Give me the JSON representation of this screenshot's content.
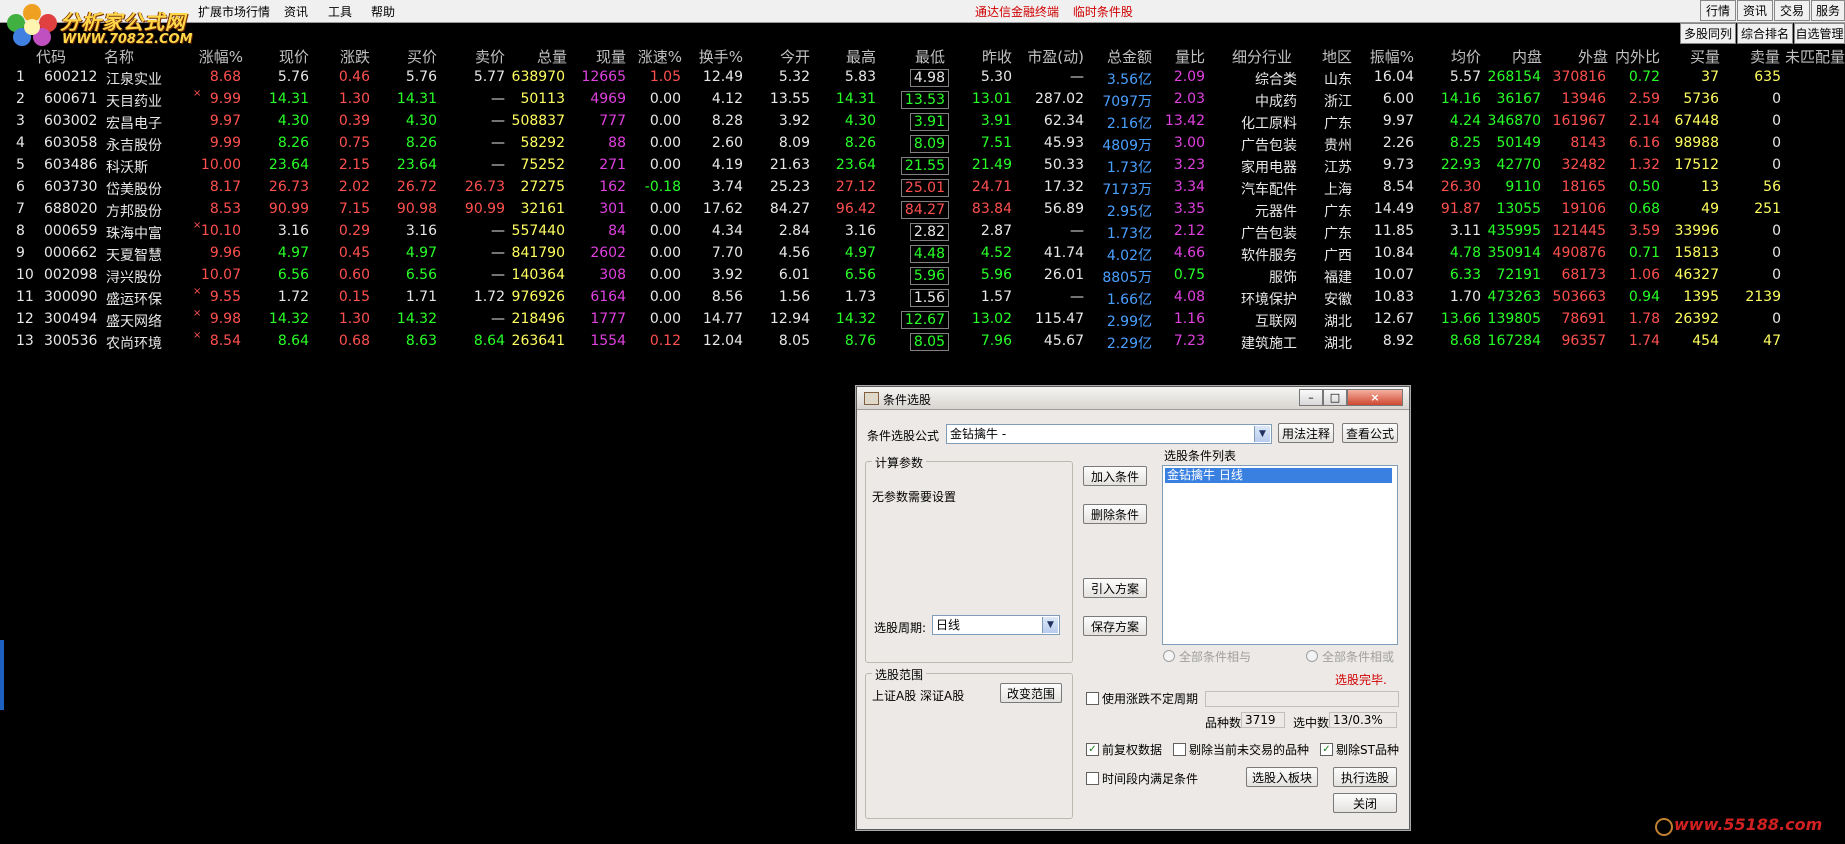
{
  "logo": {
    "brand": "分析家公式网",
    "url": "WWW.70822.COM"
  },
  "menu": [
    "扩展市场行情",
    "资讯",
    "工具",
    "帮助"
  ],
  "center_links": [
    "通达信金融终端",
    "临时条件股"
  ],
  "right_buttons": [
    "行情",
    "资讯",
    "交易",
    "服务"
  ],
  "right_buttons2": [
    "多股同列",
    "综合排名",
    "自选管理"
  ],
  "columns": [
    "代码",
    "名称",
    "涨幅%",
    "现价",
    "涨跌",
    "买价",
    "卖价",
    "总量",
    "现量",
    "涨速%",
    "换手%",
    "今开",
    "最高",
    "最低",
    "昨收",
    "市盈(动)",
    "总金额",
    "量比",
    "细分行业",
    "地区",
    "振幅%",
    "均价",
    "内盘",
    "外盘",
    "内外比",
    "买量",
    "卖量",
    "未匹配量"
  ],
  "rows": [
    [
      "1",
      "600212",
      "江泉实业",
      "",
      "8.68",
      "5.76",
      "0.46",
      "5.76",
      "5.77",
      "638970",
      "12665",
      "1.05",
      "12.49",
      "5.32",
      "5.83",
      "4.98",
      "5.30",
      "—",
      "3.56亿",
      "2.09",
      "综合类",
      "山东",
      "16.04",
      "5.57",
      "268154",
      "370816",
      "0.72",
      "37",
      "635"
    ],
    [
      "2",
      "600671",
      "天目药业",
      "×",
      "9.99",
      "14.31",
      "1.30",
      "14.31",
      "—",
      "50113",
      "4969",
      "0.00",
      "4.12",
      "13.55",
      "14.31",
      "13.53",
      "13.01",
      "287.02",
      "7097万",
      "2.03",
      "中成药",
      "浙江",
      "6.00",
      "14.16",
      "36167",
      "13946",
      "2.59",
      "5736",
      "0"
    ],
    [
      "3",
      "603002",
      "宏昌电子",
      "",
      "9.97",
      "4.30",
      "0.39",
      "4.30",
      "—",
      "508837",
      "777",
      "0.00",
      "8.28",
      "3.92",
      "4.30",
      "3.91",
      "3.91",
      "62.34",
      "2.16亿",
      "13.42",
      "化工原料",
      "广东",
      "9.97",
      "4.24",
      "346870",
      "161967",
      "2.14",
      "67448",
      "0"
    ],
    [
      "4",
      "603058",
      "永吉股份",
      "",
      "9.99",
      "8.26",
      "0.75",
      "8.26",
      "—",
      "58292",
      "88",
      "0.00",
      "2.60",
      "8.09",
      "8.26",
      "8.09",
      "7.51",
      "45.93",
      "4809万",
      "3.00",
      "广告包装",
      "贵州",
      "2.26",
      "8.25",
      "50149",
      "8143",
      "6.16",
      "98988",
      "0"
    ],
    [
      "5",
      "603486",
      "科沃斯",
      "",
      "10.00",
      "23.64",
      "2.15",
      "23.64",
      "—",
      "75252",
      "271",
      "0.00",
      "4.19",
      "21.63",
      "23.64",
      "21.55",
      "21.49",
      "50.33",
      "1.73亿",
      "3.23",
      "家用电器",
      "江苏",
      "9.73",
      "22.93",
      "42770",
      "32482",
      "1.32",
      "17512",
      "0"
    ],
    [
      "6",
      "603730",
      "岱美股份",
      "",
      "8.17",
      "26.73",
      "2.02",
      "26.72",
      "26.73",
      "27275",
      "162",
      "-0.18",
      "3.74",
      "25.23",
      "27.12",
      "25.01",
      "24.71",
      "17.32",
      "7173万",
      "3.34",
      "汽车配件",
      "上海",
      "8.54",
      "26.30",
      "9110",
      "18165",
      "0.50",
      "13",
      "56"
    ],
    [
      "7",
      "688020",
      "方邦股份",
      "",
      "8.53",
      "90.99",
      "7.15",
      "90.98",
      "90.99",
      "32161",
      "301",
      "0.00",
      "17.62",
      "84.27",
      "96.42",
      "84.27",
      "83.84",
      "56.89",
      "2.95亿",
      "3.35",
      "元器件",
      "广东",
      "14.49",
      "91.87",
      "13055",
      "19106",
      "0.68",
      "49",
      "251"
    ],
    [
      "8",
      "000659",
      "珠海中富",
      "×",
      "10.10",
      "3.16",
      "0.29",
      "3.16",
      "—",
      "557440",
      "84",
      "0.00",
      "4.34",
      "2.84",
      "3.16",
      "2.82",
      "2.87",
      "—",
      "1.73亿",
      "2.12",
      "广告包装",
      "广东",
      "11.85",
      "3.11",
      "435995",
      "121445",
      "3.59",
      "33996",
      "0"
    ],
    [
      "9",
      "000662",
      "天夏智慧",
      "",
      "9.96",
      "4.97",
      "0.45",
      "4.97",
      "—",
      "841790",
      "2602",
      "0.00",
      "7.70",
      "4.56",
      "4.97",
      "4.48",
      "4.52",
      "41.74",
      "4.02亿",
      "4.66",
      "软件服务",
      "广西",
      "10.84",
      "4.78",
      "350914",
      "490876",
      "0.71",
      "15813",
      "0"
    ],
    [
      "10",
      "002098",
      "浔兴股份",
      "",
      "10.07",
      "6.56",
      "0.60",
      "6.56",
      "—",
      "140364",
      "308",
      "0.00",
      "3.92",
      "6.01",
      "6.56",
      "5.96",
      "5.96",
      "26.01",
      "8805万",
      "0.75",
      "服饰",
      "福建",
      "10.07",
      "6.33",
      "72191",
      "68173",
      "1.06",
      "46327",
      "0"
    ],
    [
      "11",
      "300090",
      "盛运环保",
      "×",
      "9.55",
      "1.72",
      "0.15",
      "1.71",
      "1.72",
      "976926",
      "6164",
      "0.00",
      "8.56",
      "1.56",
      "1.73",
      "1.56",
      "1.57",
      "—",
      "1.66亿",
      "4.08",
      "环境保护",
      "安徽",
      "10.83",
      "1.70",
      "473263",
      "503663",
      "0.94",
      "1395",
      "2139"
    ],
    [
      "12",
      "300494",
      "盛天网络",
      "×",
      "9.98",
      "14.32",
      "1.30",
      "14.32",
      "—",
      "218496",
      "1777",
      "0.00",
      "14.77",
      "12.94",
      "14.32",
      "12.67",
      "13.02",
      "115.47",
      "2.99亿",
      "1.16",
      "互联网",
      "湖北",
      "12.67",
      "13.66",
      "139805",
      "78691",
      "1.78",
      "26392",
      "0"
    ],
    [
      "13",
      "300536",
      "农尚环境",
      "×",
      "8.54",
      "8.64",
      "0.68",
      "8.63",
      "8.64",
      "263641",
      "1554",
      "0.12",
      "12.04",
      "8.05",
      "8.76",
      "8.05",
      "7.96",
      "45.67",
      "2.29亿",
      "7.23",
      "建筑施工",
      "湖北",
      "8.92",
      "8.68",
      "167284",
      "96357",
      "1.74",
      "454",
      "47"
    ]
  ],
  "dialog": {
    "title": "条件选股",
    "formula_label": "条件选股公式",
    "formula_value": "金钻擒牛        -",
    "usage_btn": "用法注释",
    "view_btn": "查看公式",
    "params_group": "计算参数",
    "no_params": "无参数需要设置",
    "add_btn": "加入条件",
    "del_btn": "删除条件",
    "import_btn": "引入方案",
    "save_btn": "保存方案",
    "cond_list_label": "选股条件列表",
    "cond_item": "金钻擒牛   日线",
    "period_label": "选股周期:",
    "period_value": "日线",
    "radio_and": "全部条件相与",
    "radio_or": "全部条件相或",
    "done_text": "选股完毕.",
    "range_group": "选股范围",
    "range_value": "上证A股  深证A股",
    "change_range_btn": "改变范围",
    "use_updown_label": "使用涨跌不定周期",
    "count_label": "品种数",
    "count_value": "3719",
    "selected_label": "选中数",
    "selected_value": "13/0.3%",
    "chk_prefq": "前复权数据",
    "chk_exclude_notrade": "剔除当前未交易的品种",
    "chk_exclude_st": "剔除ST品种",
    "chk_period_satisfy": "时间段内满足条件",
    "to_block_btn": "选股入板块",
    "run_btn": "执行选股",
    "close_btn": "关闭"
  },
  "watermark": "www.55188.com"
}
